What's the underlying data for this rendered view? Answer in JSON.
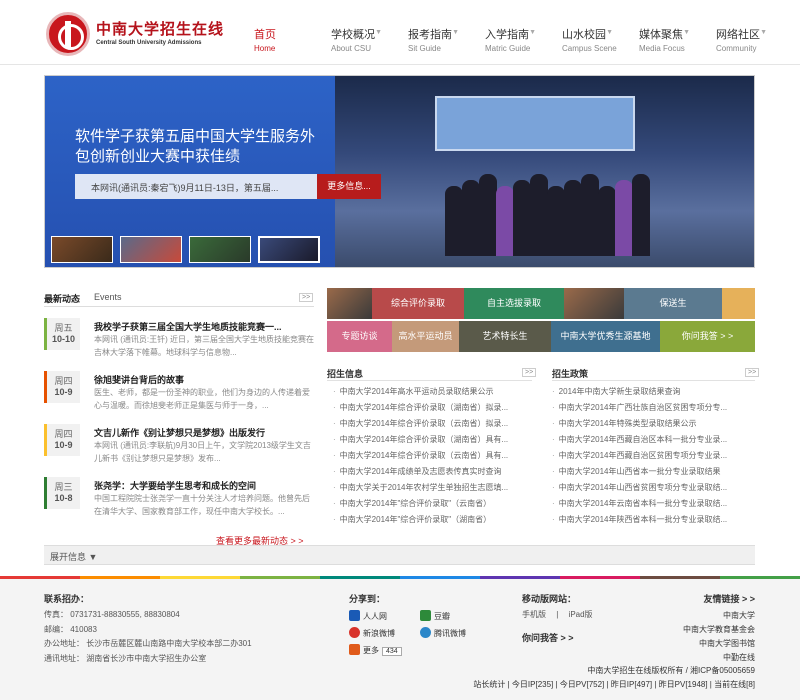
{
  "header": {
    "title": "中南大学招生在线",
    "subtitle": "Central South University Admissions",
    "nav": [
      {
        "zh": "首页",
        "en": "Home",
        "active": true
      },
      {
        "zh": "学校概况",
        "en": "About CSU"
      },
      {
        "zh": "报考指南",
        "en": "Sit Guide"
      },
      {
        "zh": "入学指南",
        "en": "Matric Guide"
      },
      {
        "zh": "山水校园",
        "en": "Campus Scene"
      },
      {
        "zh": "媒体聚焦",
        "en": "Media Focus"
      },
      {
        "zh": "网络社区",
        "en": "Community"
      }
    ]
  },
  "banner": {
    "heading": "软件学子获第五届中国大学生服务外包创新创业大赛中获佳绩",
    "desc": "本网讯(通讯员:秦宕飞)9月11日-13日，第五届...",
    "more": "更多信息..."
  },
  "news": {
    "tab_active": "最新动态",
    "tab": "Events",
    "more_label": ">>",
    "items": [
      {
        "weekday": "周五",
        "date": "10-10",
        "title": "我校学子获第三届全国大学生地质技能竞赛一...",
        "body": "本网讯 (通讯员:王钎) 近日，第三届全国大学生地质技能竞赛在吉林大学落下帷幕。地球科学与信息物..."
      },
      {
        "weekday": "周四",
        "date": "10-9",
        "title": "徐旭斐讲台背后的故事",
        "body": "医生、老师，都是一份圣神的职业，他们为身边的人传递着爱心与温暖。而徐旭斐老师正是集医与师于一身，..."
      },
      {
        "weekday": "周四",
        "date": "10-9",
        "title": "文吉儿新作《别让梦想只是梦想》出版发行",
        "body": "本网讯 (通讯员:李联航)9月30日上午，文学院2013级学生文吉儿新书《别让梦想只是梦想》发布..."
      },
      {
        "weekday": "周三",
        "date": "10-8",
        "title": "张尧学：大学要给学生思考和成长的空间",
        "body": "中国工程院院士张尧学一直十分关注人才培养问题。他曾先后在清华大学、国家教育部工作，现任中南大学校长。..."
      }
    ],
    "more_link": "查看更多最新动态 > >"
  },
  "expand": {
    "label": "展开信息 ▼"
  },
  "tiles": [
    {
      "label": "",
      "color": "#8a5a3a",
      "photo": true
    },
    {
      "label": "综合评价录取",
      "color": "#b84a4a"
    },
    {
      "label": "自主选拔录取",
      "color": "#2f8a5c"
    },
    {
      "label": "",
      "color": "#6a5a3a",
      "photo": true
    },
    {
      "label": "保送生",
      "color": "#5b7a90"
    },
    {
      "label": "",
      "color": "#e6b15a"
    },
    {
      "label": "专题访谈",
      "color": "#d46a8a"
    },
    {
      "label": "高水平运动员",
      "color": "#c49a7a"
    },
    {
      "label": "艺术特长生",
      "color": "#5a5a4a"
    },
    {
      "label": "中南大学优秀生源基地",
      "color": "#3f6f8f"
    },
    {
      "label": "你问我答 > >",
      "color": "#8aa83a"
    }
  ],
  "zsxx": {
    "head": "招生信息",
    "more": ">>",
    "items": [
      "中南大学2014年高水平运动员录取结果公示",
      "中南大学2014年综合评价录取（湖南省）拟录...",
      "中南大学2014年综合评价录取（云南省）拟录...",
      "中南大学2014年综合评价录取（湖南省）具有...",
      "中南大学2014年综合评价录取（云南省）具有...",
      "中南大学2014年成绩单及志愿表传真实时查询",
      "中南大学关于2014年农村学生单独招生志愿填...",
      "中南大学2014年\"综合评价录取\"（云南省）",
      "中南大学2014年\"综合评价录取\"（湖南省）"
    ]
  },
  "zszc": {
    "head": "招生政策",
    "more": ">>",
    "items": [
      "2014年中南大学新生录取结果查询",
      "中南大学2014年广西壮族自治区贫困专项分专...",
      "中南大学2014年特殊类型录取结果公示",
      "中南大学2014年西藏自治区本科一批分专业录...",
      "中南大学2014年西藏自治区贫困专项分专业录...",
      "中南大学2014年山西省本一批分专业录取结果",
      "中南大学2014年山西省贫困专项分专业录取结...",
      "中南大学2014年云南省本科一批分专业录取结...",
      "中南大学2014年陕西省本科一批分专业录取结..."
    ]
  },
  "footer": {
    "contact_head": "联系招办：",
    "contact": [
      "传真：  0731731-88830555, 88830804",
      "邮编：  410083",
      "办公地址：  长沙市岳麓区麓山南路中南大学校本部二办301",
      "通讯地址：  湖南省长沙市中南大学招生办公室"
    ],
    "share_head": "分享到：",
    "share": [
      {
        "label": "人人网",
        "color": "#1a5ab5"
      },
      {
        "label": "豆瓣",
        "color": "#2d8a3a"
      },
      {
        "label": "新浪微博",
        "color": "#d8322a"
      },
      {
        "label": "腾讯微博",
        "color": "#2b87c9"
      },
      {
        "label": "更多",
        "color": "#e05a1a"
      }
    ],
    "share_count": "434",
    "mobile_head": "移动版网站：",
    "mobile_links": [
      "手机版",
      "|",
      "iPad版"
    ],
    "qa_head": "你问我答 > >",
    "links_head": "友情链接 > >",
    "links": [
      "中南大学",
      "中南大学教育基金会",
      "中南大学图书馆",
      "中勤在线"
    ],
    "copyright": "中南大学招生在线版权所有 / 湘ICP备05005659",
    "stats": "站长统计 | 今日IP[235] | 今日PV[752] | 昨日IP[497] | 昨日PV[1948] | 当前在线[8]"
  },
  "colors": {
    "brand_red": "#c8161d",
    "rainbow": [
      "#e53935",
      "#fb8c00",
      "#fdd835",
      "#7cb342",
      "#00897b",
      "#1e88e5",
      "#5e35b1",
      "#d81b60",
      "#6d4c41",
      "#43a047"
    ]
  }
}
